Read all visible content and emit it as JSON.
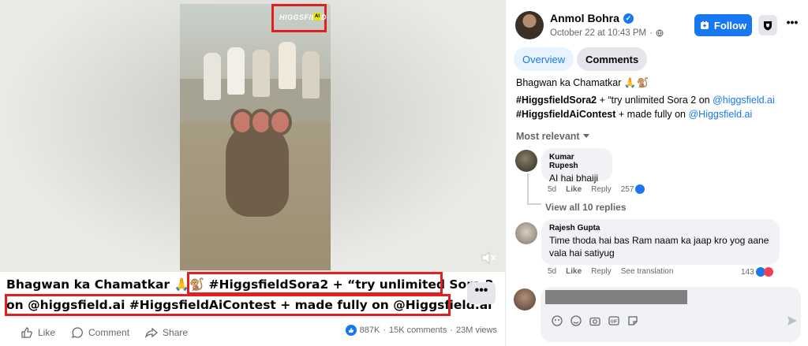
{
  "post": {
    "title_line1_plain": "Bhagwan ka Chamatkar 🙏🐒 ",
    "title_line1_tagged": "#HiggsfieldSora2 + “try unlimited Sora 2",
    "title_line2": "on @higgsfield.ai #HiggsfieldAiContest + made fully on @Higgsfield.ai",
    "more_label": "•••",
    "watermark": "HIGGSFIELD",
    "watermark_badge": "AI",
    "actions": {
      "like": "Like",
      "comment": "Comment",
      "share": "Share"
    },
    "stats": {
      "reactions": "887K",
      "comments": "15K comments",
      "views": "23M views",
      "sep": "·"
    }
  },
  "panel": {
    "author": "Anmol Bohra",
    "date": "October 22 at 10:43 PM",
    "date_sep": "·",
    "follow_label": "Follow",
    "tabs": {
      "overview": "Overview",
      "comments": "Comments"
    },
    "desc_line1": "Bhagwan ka Chamatkar 🙏🐒",
    "desc_tag1": "#HiggsfieldSora2",
    "desc_mid1": " + “try unlimited Sora 2 on ",
    "desc_link1": "@higgsfield.ai",
    "desc_tag2": "#HiggsfieldAiContest",
    "desc_mid2": " + made fully on ",
    "desc_link2": "@Higgsfield.ai",
    "sort_label": "Most relevant"
  },
  "comments": [
    {
      "name": "Kumar Rupesh",
      "text": "AI hai bhaiji",
      "age": "5d",
      "like": "Like",
      "reply": "Reply",
      "count": "257"
    },
    {
      "name": "Rajesh Gupta",
      "text": "Time thoda hai bas Ram naam ka jaap kro yog aane vala hai satiyug",
      "age": "5d",
      "like": "Like",
      "reply": "Reply",
      "translate": "See translation",
      "count": "143"
    }
  ],
  "view_replies": "View all 10 replies",
  "colors": {
    "accent": "#1877f2",
    "highlight_border": "#e02020",
    "muted": "#65676b",
    "bubble": "#f0f2f5"
  }
}
